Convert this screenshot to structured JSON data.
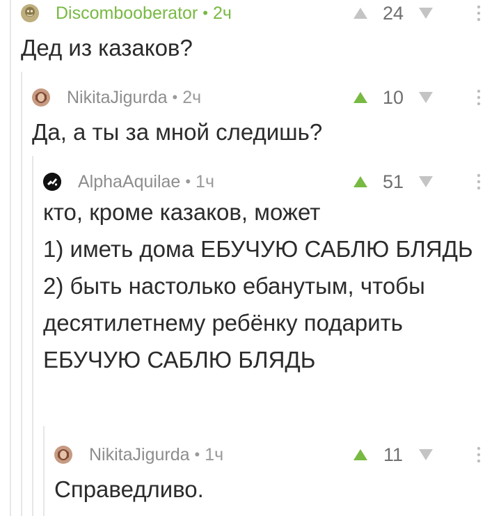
{
  "colors": {
    "op_green": "#78b942",
    "upvote_active": "#78b942",
    "upvote_inactive": "#c4c4c4",
    "downvote": "#c4c4c4",
    "thread_line": "#e6e6e6",
    "text": "#2b2b2b",
    "meta": "#8d8d8d"
  },
  "comments": [
    {
      "author": "Discombooberator",
      "separator": "•",
      "time": "2ч",
      "rating": "24",
      "body": "Дед из казаков?",
      "is_op": true,
      "upvoted": false,
      "avatar_icon": "avatar-icon"
    },
    {
      "author": "NikitaJigurda",
      "separator": "•",
      "time": "2ч",
      "rating": "10",
      "body": "Да, а ты за мной следишь?",
      "is_op": false,
      "upvoted": true,
      "avatar_icon": "avatar-icon"
    },
    {
      "author": "AlphaAquilae",
      "separator": "•",
      "time": "1ч",
      "rating": "51",
      "body": "кто, кроме казаков, может\n1) иметь дома ЕБУЧУЮ САБЛЮ БЛЯДЬ\n2) быть настолько ебанутым, чтобы десятилетнему ребёнку подарить ЕБУЧУЮ САБЛЮ БЛЯДЬ",
      "is_op": false,
      "upvoted": true,
      "avatar_icon": "avatar-icon"
    },
    {
      "author": "NikitaJigurda",
      "separator": "•",
      "time": "1ч",
      "rating": "11",
      "body": "Справедливо.",
      "is_op": false,
      "upvoted": true,
      "avatar_icon": "avatar-icon"
    }
  ]
}
